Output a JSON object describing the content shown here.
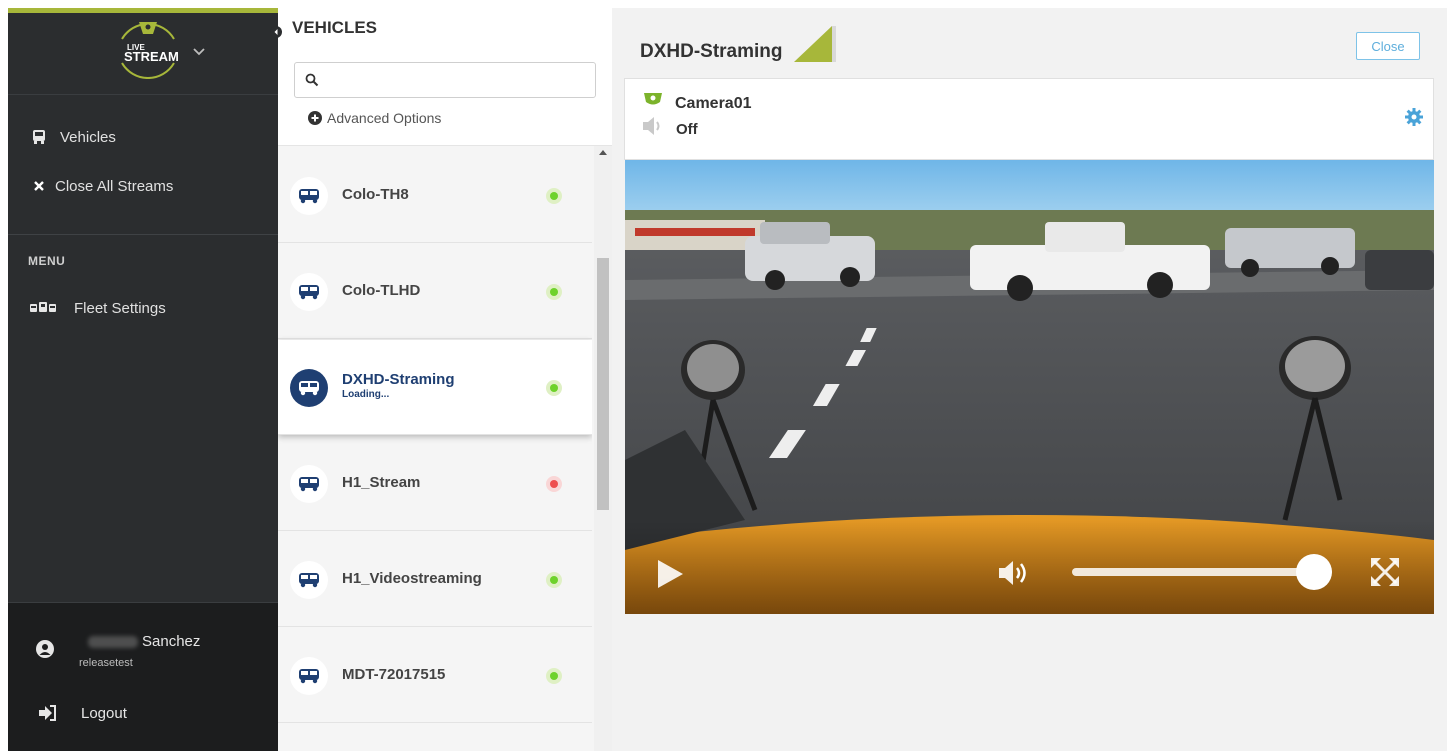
{
  "sidebar": {
    "logo": {
      "line1": "LIVE",
      "line2": "STREAM"
    },
    "nav": [
      {
        "label": "Vehicles",
        "icon": "bus-icon"
      },
      {
        "label": "Close All Streams",
        "icon": "close-icon"
      }
    ],
    "menu_heading": "MENU",
    "menu_items": [
      {
        "label": "Fleet Settings",
        "icon": "fleet-icon"
      }
    ],
    "user": {
      "name": "Sanchez",
      "account": "releasetest",
      "icon": "user-icon"
    },
    "logout_label": "Logout"
  },
  "vehicles_panel": {
    "title": "VEHICLES",
    "search": {
      "value": "",
      "placeholder": ""
    },
    "advanced_options_label": "Advanced Options",
    "items": [
      {
        "name": "Colo-TH8",
        "status": "online",
        "active": false,
        "sub": ""
      },
      {
        "name": "Colo-TLHD",
        "status": "online",
        "active": false,
        "sub": ""
      },
      {
        "name": "DXHD-Straming",
        "status": "online",
        "active": true,
        "sub": "Loading..."
      },
      {
        "name": "H1_Stream",
        "status": "offline",
        "active": false,
        "sub": ""
      },
      {
        "name": "H1_Videostreaming",
        "status": "online",
        "active": false,
        "sub": ""
      },
      {
        "name": "MDT-72017515",
        "status": "online",
        "active": false,
        "sub": ""
      }
    ]
  },
  "main": {
    "title": "DXHD-Straming",
    "close_label": "Close",
    "camera": {
      "name": "Camera01",
      "audio_status": "Off"
    },
    "player": {
      "volume_level": 1.0
    }
  },
  "colors": {
    "accent": "#a7b73a",
    "active_blue": "#1f3f72",
    "online": "#6ed22b",
    "offline": "#ee4d4d",
    "link": "#5eaedc"
  }
}
